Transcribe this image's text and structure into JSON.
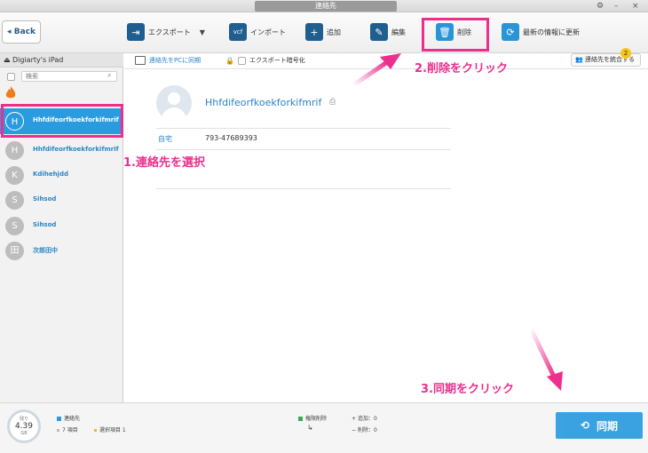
{
  "window": {
    "title": "連絡先",
    "controls": [
      "⚙",
      "–",
      "×"
    ]
  },
  "toolbar": {
    "back_label": "Back",
    "export_label": "エクスポート",
    "import_label": "インポート",
    "add_label": "追加",
    "edit_label": "編集",
    "delete_label": "削除",
    "refresh_label": "最新の情報に更新"
  },
  "sidebar": {
    "device_name": "Digiarty's iPad",
    "search_placeholder": "検索",
    "contacts": [
      {
        "initial": "H",
        "name": "Hhfdifeorfkoekforkifmrif",
        "selected": true
      },
      {
        "initial": "H",
        "name": "Hhfdifeorfkoekforkifmrif",
        "selected": false
      },
      {
        "initial": "K",
        "name": "Kdihehjdd",
        "selected": false
      },
      {
        "initial": "S",
        "name": "Sihsod",
        "selected": false
      },
      {
        "initial": "S",
        "name": "Sihsod",
        "selected": false
      },
      {
        "initial": "田",
        "name": "次郎田中",
        "selected": false
      }
    ]
  },
  "subtoolbar": {
    "sync_pc_label": "連絡先をPCに同期",
    "encrypt_label": "エクスポート暗号化",
    "merge_label": "連絡先を統合する",
    "merge_count": "2"
  },
  "detail": {
    "name": "Hhfdifeorfkoekforkifmrif",
    "phone_label": "自宅",
    "phone_value": "793-47689393"
  },
  "annotations": {
    "step1": "1.連絡先を選択",
    "step2": "2.削除をクリック",
    "step3": "3.同期をクリック"
  },
  "bottombar": {
    "storage_top": "残り",
    "storage_value": "4.39",
    "storage_unit": "GB",
    "section_name": "連絡先",
    "items_count": "7 項目",
    "selected_count": "選択項目 1",
    "perm_delete": "権限削除",
    "added": "追加：0",
    "deleted": "削除：0",
    "sync_label": "同期"
  },
  "colors": {
    "accent": "#2b9be0",
    "annotation": "#ec2f8d"
  }
}
